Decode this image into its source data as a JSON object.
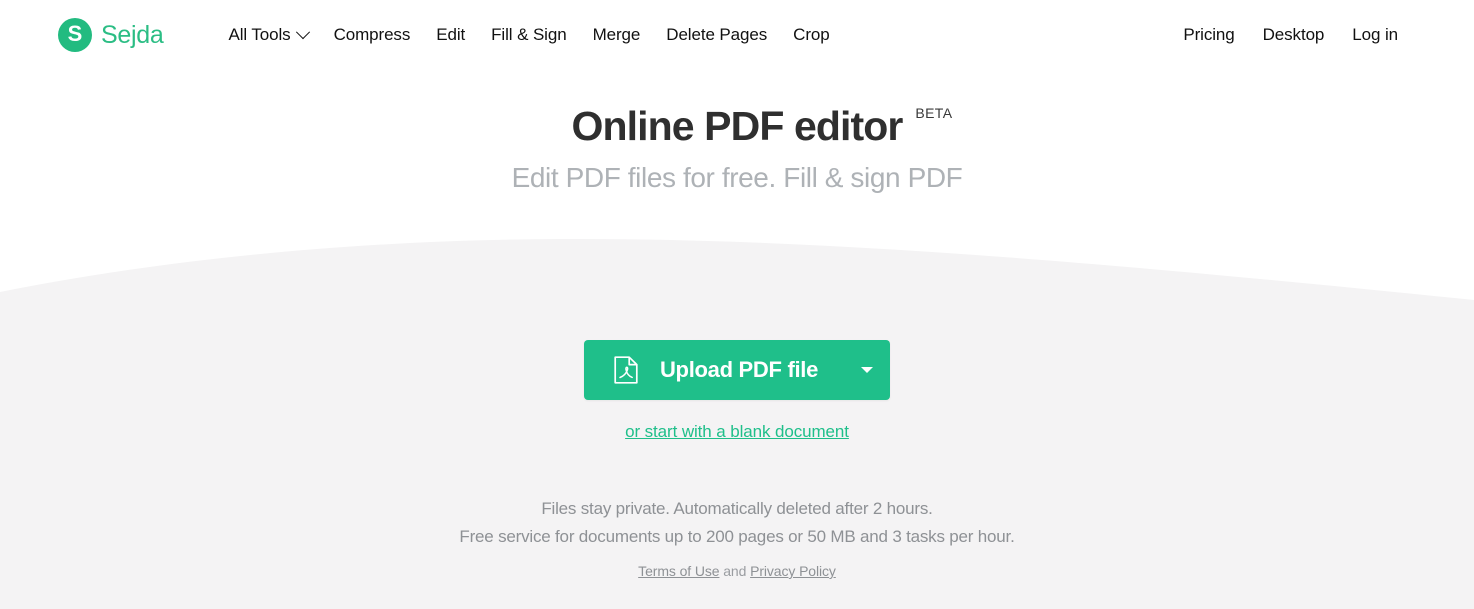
{
  "brand": {
    "mark_letter": "S",
    "name": "Sejda",
    "color": "#2bbd84"
  },
  "header": {
    "nav_left": [
      {
        "label": "All Tools",
        "has_dropdown": true
      },
      {
        "label": "Compress",
        "has_dropdown": false
      },
      {
        "label": "Edit",
        "has_dropdown": false
      },
      {
        "label": "Fill & Sign",
        "has_dropdown": false
      },
      {
        "label": "Merge",
        "has_dropdown": false
      },
      {
        "label": "Delete Pages",
        "has_dropdown": false
      },
      {
        "label": "Crop",
        "has_dropdown": false
      }
    ],
    "nav_right": [
      {
        "label": "Pricing"
      },
      {
        "label": "Desktop"
      },
      {
        "label": "Log in"
      }
    ]
  },
  "hero": {
    "title": "Online PDF editor",
    "badge": "BETA",
    "subtitle": "Edit PDF files for free. Fill & sign PDF"
  },
  "main": {
    "upload_button": {
      "label": "Upload PDF file",
      "icon": "pdf-file-icon",
      "dropdown_icon": "caret-down-icon",
      "color": "#1fbf8a"
    },
    "blank_document_link": "or start with a blank document",
    "notes": [
      "Files stay private. Automatically deleted after 2 hours.",
      "Free service for documents up to 200 pages or 50 MB and 3 tasks per hour."
    ],
    "legal": {
      "terms": "Terms of Use",
      "conjunction": " and ",
      "privacy": "Privacy Policy"
    }
  },
  "colors": {
    "accent_green": "#1fbf8a",
    "page_background": "#f4f3f4",
    "hero_background": "#ffffff"
  }
}
